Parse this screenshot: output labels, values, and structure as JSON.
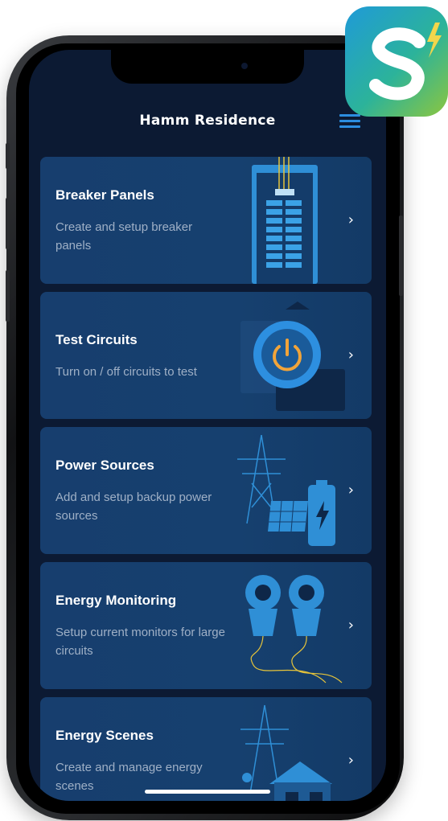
{
  "header": {
    "title": "Hamm Residence",
    "menu_icon": "hamburger-menu-icon"
  },
  "cards": [
    {
      "title": "Breaker Panels",
      "description": "Create and setup breaker panels",
      "illustration": "breaker-panel-illustration"
    },
    {
      "title": "Test Circuits",
      "description": "Turn on / off circuits to test",
      "illustration": "power-button-illustration"
    },
    {
      "title": "Power Sources",
      "description": "Add and setup backup power sources",
      "illustration": "power-tower-solar-battery-illustration"
    },
    {
      "title": "Energy Monitoring",
      "description": "Setup current monitors for large circuits",
      "illustration": "current-clamps-illustration"
    },
    {
      "title": "Energy Scenes",
      "description": "Create and manage energy scenes",
      "illustration": "tower-house-illustration"
    }
  ],
  "chevron": "›",
  "colors": {
    "background": "#0c1a33",
    "card": "#16406f",
    "accent": "#2c8de0",
    "power_ring": "#f0a43a"
  },
  "app_icon": {
    "letter": "S",
    "name": "app-logo-icon"
  }
}
